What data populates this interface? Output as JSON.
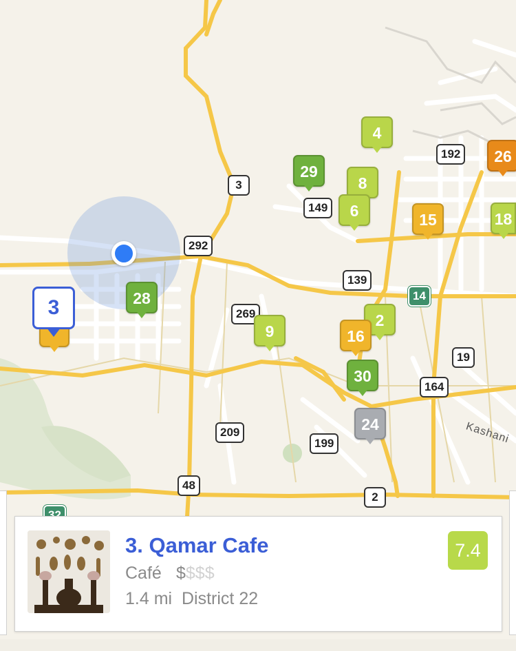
{
  "map": {
    "route_shields": [
      {
        "label": "3",
        "style": "white"
      },
      {
        "label": "292",
        "style": "white"
      },
      {
        "label": "149",
        "style": "white"
      },
      {
        "label": "192",
        "style": "white"
      },
      {
        "label": "139",
        "style": "white"
      },
      {
        "label": "14",
        "style": "green"
      },
      {
        "label": "269",
        "style": "white"
      },
      {
        "label": "19",
        "style": "white"
      },
      {
        "label": "164",
        "style": "white"
      },
      {
        "label": "209",
        "style": "white"
      },
      {
        "label": "199",
        "style": "white"
      },
      {
        "label": "48",
        "style": "white"
      },
      {
        "label": "2",
        "style": "white"
      },
      {
        "label": "32",
        "style": "green"
      }
    ],
    "street_label": "Kashani",
    "pins": [
      {
        "label": "4",
        "color": "#b9d64a"
      },
      {
        "label": "29",
        "color": "#6fb13e"
      },
      {
        "label": "8",
        "color": "#b9d64a"
      },
      {
        "label": "6",
        "color": "#b9d64a"
      },
      {
        "label": "26",
        "color": "#e88a1a"
      },
      {
        "label": "15",
        "color": "#f0b52b"
      },
      {
        "label": "18",
        "color": "#b9d64a"
      },
      {
        "label": "28",
        "color": "#6fb13e"
      },
      {
        "label": "9",
        "color": "#b9d64a"
      },
      {
        "label": "2",
        "color": "#b9d64a"
      },
      {
        "label": "16",
        "color": "#f0b52b"
      },
      {
        "label": "30",
        "color": "#6fb13e"
      },
      {
        "label": "24",
        "color": "#a9acb1"
      }
    ],
    "selected_pin": {
      "label": "3",
      "color": "#3b5ed6"
    }
  },
  "card": {
    "title": "3. Qamar Cafe",
    "category": "Café",
    "price_active": "$",
    "price_inactive": "$$$",
    "distance": "1.4 mi",
    "neighborhood": "District 22",
    "rating": "7.4",
    "rating_color": "#b8d94a"
  }
}
